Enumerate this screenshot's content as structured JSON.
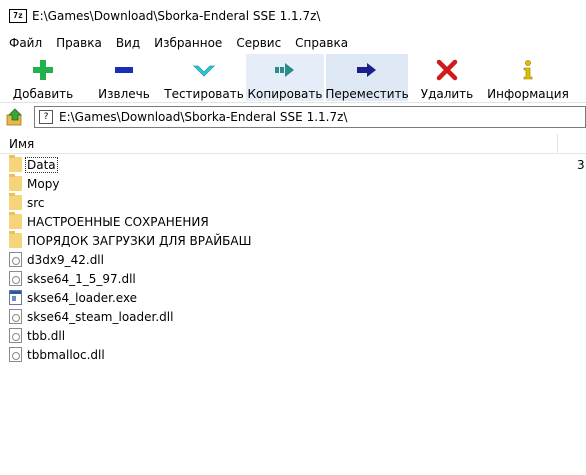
{
  "window": {
    "title": "E:\\Games\\Download\\Sborka-Enderal SSE 1.1.7z\\",
    "app_icon_text": "7z"
  },
  "menu": [
    "Файл",
    "Правка",
    "Вид",
    "Избранное",
    "Сервис",
    "Справка"
  ],
  "toolbar": {
    "add": "Добавить",
    "extract": "Извлечь",
    "test": "Тестировать",
    "copy": "Копировать",
    "move": "Переместить",
    "delete": "Удалить",
    "info": "Информация"
  },
  "address": {
    "path": "E:\\Games\\Download\\Sborka-Enderal SSE 1.1.7z\\"
  },
  "columns": {
    "name": "Имя"
  },
  "files": [
    {
      "name": "Data",
      "type": "folder",
      "size": "3"
    },
    {
      "name": "Mopy",
      "type": "folder"
    },
    {
      "name": "src",
      "type": "folder"
    },
    {
      "name": "НАСТРОЕННЫЕ СОХРАНЕНИЯ",
      "type": "folder"
    },
    {
      "name": "ПОРЯДОК ЗАГРУЗКИ ДЛЯ ВРАЙБАШ",
      "type": "folder"
    },
    {
      "name": "d3dx9_42.dll",
      "type": "dll"
    },
    {
      "name": "skse64_1_5_97.dll",
      "type": "dll"
    },
    {
      "name": "skse64_loader.exe",
      "type": "exe"
    },
    {
      "name": "skse64_steam_loader.dll",
      "type": "dll"
    },
    {
      "name": "tbb.dll",
      "type": "dll"
    },
    {
      "name": "tbbmalloc.dll",
      "type": "dll"
    }
  ],
  "colors": {
    "add": "#22b24c",
    "extract": "#1a2fb5",
    "test": "#2ec7d6",
    "copy": "#2b8a8a",
    "move": "#1a1f8a",
    "delete": "#d11a1a",
    "info": "#e0c000"
  }
}
